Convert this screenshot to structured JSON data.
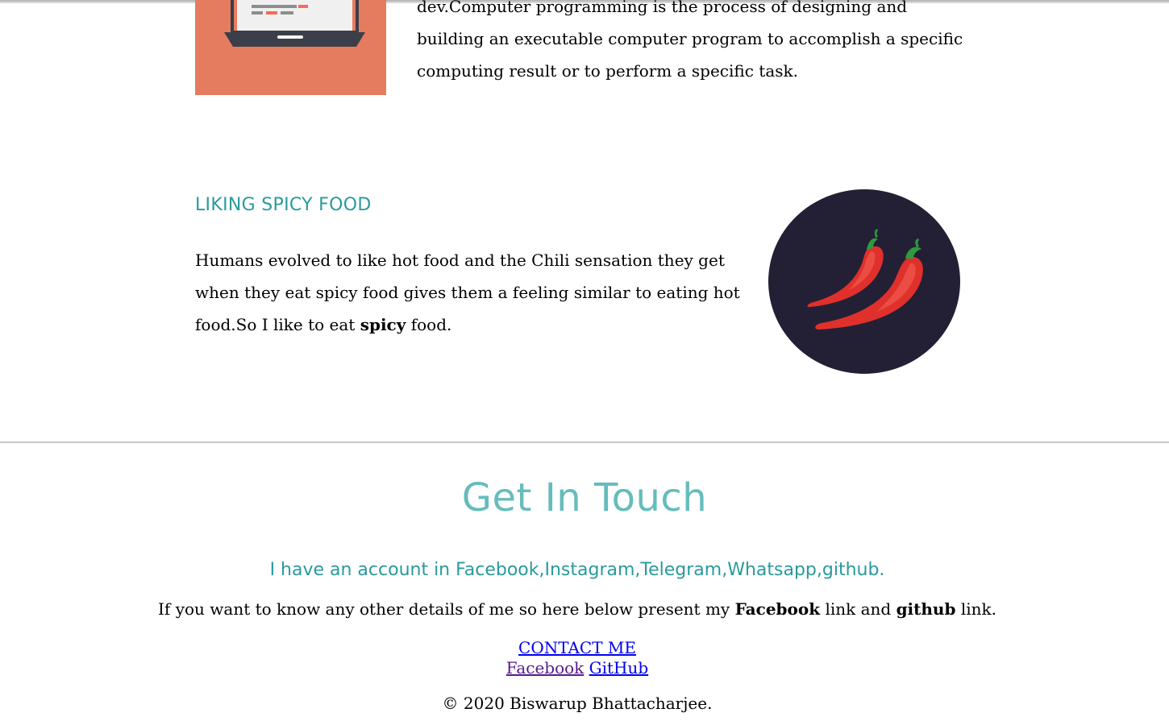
{
  "programming": {
    "text": "dev.Computer programming is the process of designing and building an executable computer program to accomplish a specific computing result or to perform a specific task."
  },
  "food": {
    "title": "LIKING SPICY FOOD",
    "text_before": "Humans evolved to like hot food and the Chili sensation they get when they eat spicy food gives them a feeling similar to eating hot food.So I like to eat",
    "bold_word": "spicy",
    "text_after": "food."
  },
  "contact": {
    "title": "Get In Touch",
    "accounts": "I have an account in Facebook,Instagram,Telegram,Whatsapp,github.",
    "details_prefix": "If you want to know any other details of me so here below present my",
    "facebook_bold": "Facebook",
    "details_mid": "link and",
    "github_bold": "github",
    "details_suffix": "link.",
    "contact_me": "CONTACT ME",
    "facebook_link": "Facebook",
    "github_link": "GitHub",
    "copyright": "© 2020 Biswarup Bhattacharjee."
  },
  "colors": {
    "accent_teal": "#2a9a9c",
    "title_teal": "#66bcbc",
    "laptop_tile": "#e57c60",
    "chili_bg": "#232035"
  }
}
